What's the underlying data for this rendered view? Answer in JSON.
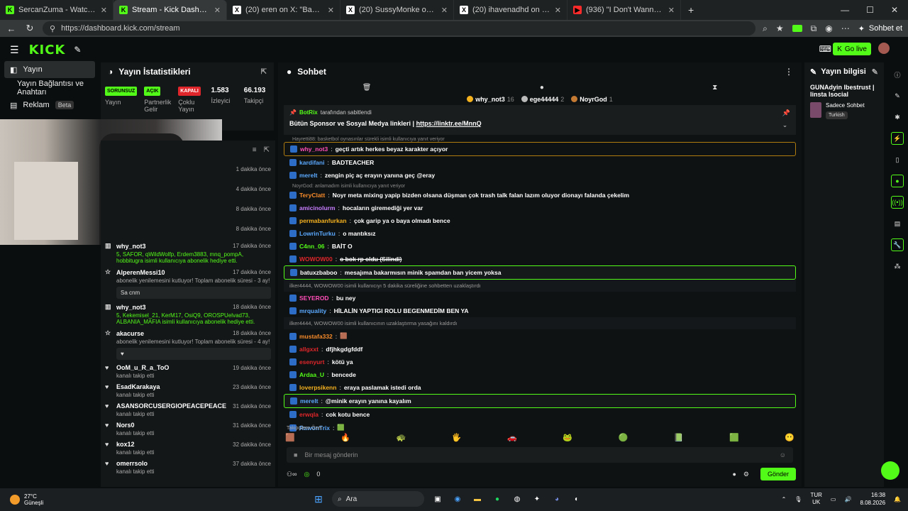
{
  "browser": {
    "tabs": [
      {
        "label": "SercanZuma - Watch clips on Kick",
        "fav": "K",
        "fav_color": "#53fc18",
        "active": false
      },
      {
        "label": "Stream - Kick Dashboard",
        "fav": "K",
        "fav_color": "#53fc18",
        "active": true
      },
      {
        "label": "(20) eren on X: \"Babası zengin diye...",
        "fav": "X",
        "fav_color": "#ffffff",
        "active": false
      },
      {
        "label": "(20) SussyMonke on X: \"Miniğin K...",
        "fav": "X",
        "fav_color": "#ffffff",
        "active": false
      },
      {
        "label": "(20) ihavenadhd on X: \"Şehmus &...",
        "fav": "X",
        "fav_color": "#ffffff",
        "active": false
      },
      {
        "label": "(936) \"I Don't Wanna Go\"- Spider-...",
        "fav": "▶",
        "fav_color": "#ff2a2a",
        "active": false
      }
    ],
    "url": "https://dashboard.kick.com/stream",
    "chat_button": "Sohbet et"
  },
  "app": {
    "logo": "KICK",
    "go_live": "Go live"
  },
  "leftnav": {
    "items": [
      {
        "label": "Yayın",
        "active": true
      },
      {
        "label": "Yayın Bağlantısı ve Anahtarı",
        "active": false
      },
      {
        "label": "Reklam",
        "active": false,
        "badge": "Beta"
      }
    ]
  },
  "stats": {
    "title": "Yayın İstatistikleri",
    "items": [
      {
        "pill": "SORUNSUZ",
        "pill_color": "#53fc18",
        "label": "Yayın"
      },
      {
        "pill": "AÇIK",
        "pill_color": "#53fc18",
        "label": "Partnerlik Gelir"
      },
      {
        "pill": "KAPALI",
        "pill_color": "#e0262a",
        "label": "Çoklu Yayın"
      },
      {
        "num": "1.583",
        "label": "İzleyici"
      },
      {
        "num": "66.193",
        "label": "Takipçi"
      }
    ]
  },
  "activity": {
    "blank_times": [
      "1 dakika önce",
      "4 dakika önce",
      "8 dakika önce",
      "8 dakika önce"
    ],
    "items": [
      {
        "name": "why_not3",
        "time": "17 dakika önce",
        "icon": "gift",
        "sub": "5, SAFOR, qWildWolfp, Erdem3883, mnq_pompA, hobbitugra isimli kullanıcıya abonelik hediye etti.",
        "green": true
      },
      {
        "name": "AlperenMessi10",
        "time": "17 dakika önce",
        "icon": "star",
        "sub": "abonelik yenilemesini kutluyor! Toplam abonelik süresi - 3 ay!",
        "msg": "Sa cnm"
      },
      {
        "name": "why_not3",
        "time": "18 dakika önce",
        "icon": "gift",
        "sub": "5, Kekemisel_21, KerM17, OsiQ9, OROSPUelvad73, ALBANIA_MAFIA isimli kullanıcıya abonelik hediye etti.",
        "green": true
      },
      {
        "name": "akacurse",
        "time": "18 dakika önce",
        "icon": "star",
        "sub": "abonelik yenilemesini kutluyor! Toplam abonelik süresi - 4 ay!",
        "msg": "♥"
      },
      {
        "name": "OoM_u_R_a_ToO",
        "time": "19 dakika önce",
        "icon": "heart",
        "sub": "kanalı takip etti"
      },
      {
        "name": "EsadKarakaya",
        "time": "23 dakika önce",
        "icon": "heart",
        "sub": "kanalı takip etti"
      },
      {
        "name": "ASANSORCUSERGIOPEACEPEACE",
        "time": "31 dakika önce",
        "icon": "heart",
        "sub": "kanalı takip etti"
      },
      {
        "name": "Nors0",
        "time": "31 dakika önce",
        "icon": "heart",
        "sub": "kanalı takip etti"
      },
      {
        "name": "kox12",
        "time": "32 dakika önce",
        "icon": "heart",
        "sub": "kanalı takip etti"
      },
      {
        "name": "omerrsolo",
        "time": "37 dakika önce",
        "icon": "heart",
        "sub": "kanalı takip etti"
      }
    ]
  },
  "chat": {
    "title": "Sohbet",
    "gifters": [
      {
        "name": "why_not3",
        "count": "16",
        "color": "#f5b21f"
      },
      {
        "name": "ege44444",
        "count": "2",
        "color": "#bbbbbb"
      },
      {
        "name": "NoyrGod",
        "count": "1",
        "color": "#c47a33"
      }
    ],
    "pinned": {
      "by_user": "BotRix",
      "by_suffix": "tarafından sabitlendi",
      "text": "Bütün Sponsor ve Sosyal Medya linkleri | ",
      "link": "https://linktr.ee/MnnQ"
    },
    "messages": [
      {
        "kind": "reply",
        "text": "Hayretti88: basketbol oynasınlar sürekli isimli kullanıcıya yanıt veriyor"
      },
      {
        "kind": "msg",
        "user": "why_not3",
        "color": "#ff4db8",
        "text": "geçti artık herkes beyaz karakter açıyor",
        "style": "hlo"
      },
      {
        "kind": "msg",
        "user": "kardifani",
        "color": "#5aa9ff",
        "text": "BADTEACHER"
      },
      {
        "kind": "msg",
        "user": "merelt",
        "color": "#5aa9ff",
        "text": "zengin piç aç erayın yanına geç @eray"
      },
      {
        "kind": "reply",
        "text": "NoyrGod: anlamadım isimli kullanıcıya yanıt veriyor"
      },
      {
        "kind": "msg",
        "user": "TeryClatt",
        "color": "#f58a2a",
        "text": "Noyr meta mixing yapip bizden olsana düşman çok trash talk falan lazım oluyor dionayı falanda çekelim"
      },
      {
        "kind": "msg",
        "user": "amicinolurm",
        "color": "#c77dff",
        "text": "hocaların giremediği yer var"
      },
      {
        "kind": "msg",
        "user": "permabanfurkan",
        "color": "#f5b21f",
        "text": "çok garip ya o baya olmadı bence"
      },
      {
        "kind": "msg",
        "user": "LowrinTurku",
        "color": "#5aa9ff",
        "text": "o mantıksız"
      },
      {
        "kind": "msg",
        "user": "C4nn_06",
        "color": "#53fc18",
        "text": "BAİT O"
      },
      {
        "kind": "msg",
        "user": "WOWOW00",
        "color": "#e0262a",
        "text": "o bok rp oldu (Silindi)",
        "deleted": true
      },
      {
        "kind": "msg",
        "user": "batuxzbaboo",
        "color": "#ffffff",
        "text": "mesajıma bakarmısın minik spamdan ban yicem yoksa",
        "style": "hl"
      },
      {
        "kind": "sys",
        "text": "ilker4444, WOWOW00 isimli kullanıcıyı 5 dakika süreliğine sohbetten uzaklaştırdı"
      },
      {
        "kind": "msg",
        "user": "SEYEROD",
        "color": "#ff4db8",
        "text": "bu ney"
      },
      {
        "kind": "msg",
        "user": "mrquality",
        "color": "#5aa9ff",
        "text": "HİLALİN YAPTIGI ROLU BEGENMEDİM BEN YA"
      },
      {
        "kind": "sys",
        "text": "ilker4444, WOWOW00 isimli kullanıcının uzaklaştırma yasağını kaldırdı"
      },
      {
        "kind": "msg",
        "user": "mustafa332",
        "color": "#f58a2a",
        "text": "🟫"
      },
      {
        "kind": "msg",
        "user": "allgxxt",
        "color": "#e0262a",
        "text": "dfjhkgdgfddf"
      },
      {
        "kind": "msg",
        "user": "esenyurt",
        "color": "#e0262a",
        "text": "kötü ya"
      },
      {
        "kind": "msg",
        "user": "Ardaa_U",
        "color": "#53fc18",
        "text": "bencede"
      },
      {
        "kind": "msg",
        "user": "loverpsikenn",
        "color": "#f5b21f",
        "text": "eraya paslamak istedi orda"
      },
      {
        "kind": "msg",
        "user": "merelt",
        "color": "#5aa9ff",
        "text": "@minik erayın yanına kayalım",
        "style": "hl"
      },
      {
        "kind": "msg",
        "user": "erwqla",
        "color": "#e0262a",
        "text": "cok kotu bence"
      },
      {
        "kind": "msg",
        "user": "RawonTrix",
        "color": "#5aa9ff",
        "text": "🟩"
      }
    ],
    "emotes_label": "Takipçilere Özel",
    "emotes": [
      "🟫",
      "🔥",
      "🐢",
      "🖐",
      "🚗",
      "🐸",
      "🟢",
      "📗",
      "🟩",
      "😶"
    ],
    "input_placeholder": "Bir mesaj gönderin",
    "viewer_count": "0",
    "send": "Gönder"
  },
  "info": {
    "title": "Yayın bilgisi",
    "stream_title": "GUNAdyin Ibestrust | Iinsta Isocial",
    "category": "Sadece Sohbet",
    "language": "Turkish"
  },
  "taskbar": {
    "temp": "27°C",
    "weather": "Güneşli",
    "search": "Ara",
    "lang_1": "TUR",
    "lang_2": "UK",
    "time": "16:38",
    "date": "8.08.2026"
  }
}
